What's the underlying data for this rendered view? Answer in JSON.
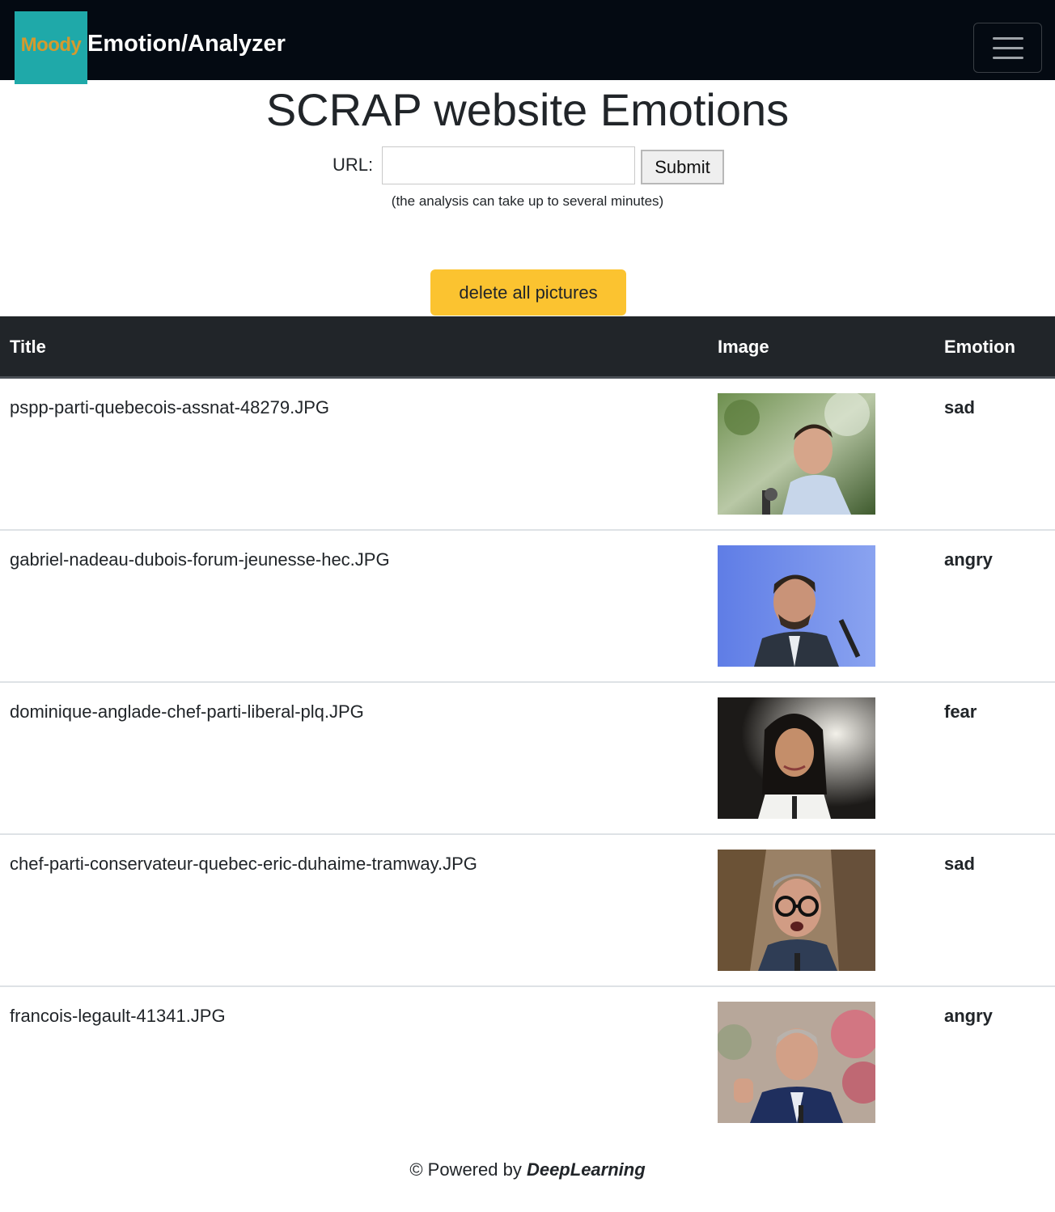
{
  "navbar": {
    "logo_text": "Moody",
    "brand": "Emotion/Analyzer",
    "menu_icon": "hamburger-menu-icon"
  },
  "page": {
    "title": "SCRAP website Emotions"
  },
  "form": {
    "url_label": "URL:",
    "url_value": "",
    "submit_label": "Submit",
    "hint": "(the analysis can take up to several minutes)"
  },
  "actions": {
    "delete_label": "delete all pictures"
  },
  "table": {
    "headers": [
      "Title",
      "Image",
      "Emotion"
    ],
    "rows": [
      {
        "title": "pspp-parti-quebecois-assnat-48279.JPG",
        "emotion": "sad"
      },
      {
        "title": "gabriel-nadeau-dubois-forum-jeunesse-hec.JPG",
        "emotion": "angry"
      },
      {
        "title": "dominique-anglade-chef-parti-liberal-plq.JPG",
        "emotion": "fear"
      },
      {
        "title": "chef-parti-conservateur-quebec-eric-duhaime-tramway.JPG",
        "emotion": "sad"
      },
      {
        "title": "francois-legault-41341.JPG",
        "emotion": "angry"
      }
    ]
  },
  "footer": {
    "prefix": "© Powered by",
    "brand": "DeepLearning"
  },
  "colors": {
    "navbar": "#040a12",
    "logo_bg": "#1fa9a9",
    "logo_text": "#d49a2e",
    "warning": "#fbc330",
    "table_header": "#212529"
  }
}
